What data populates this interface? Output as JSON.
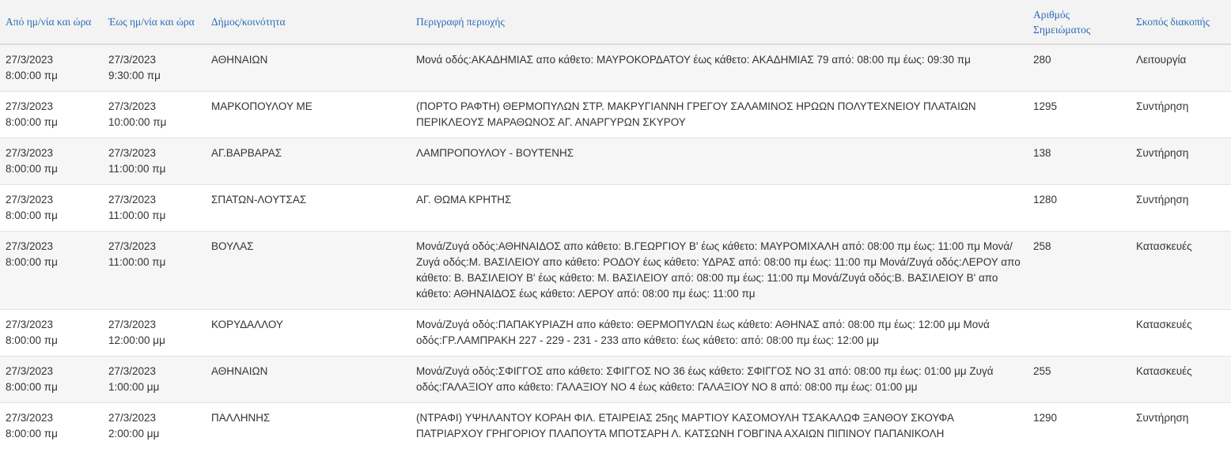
{
  "table": {
    "headers": {
      "from": "Από ημ/νία και ώρα",
      "to": "Έως ημ/νία και ώρα",
      "municipality": "Δήμος/κοινότητα",
      "description": "Περιγραφή περιοχής",
      "ref_line1": "Αριθμός",
      "ref_line2": "Σημειώματος",
      "purpose": "Σκοπός διακοπής"
    },
    "rows": [
      {
        "from_date": "27/3/2023",
        "from_time": "8:00:00 πμ",
        "to_date": "27/3/2023",
        "to_time": "9:30:00 πμ",
        "municipality": "ΑΘΗΝΑΙΩΝ",
        "description": "Μονά οδός:ΑΚΑΔΗΜΙΑΣ απο κάθετο: ΜΑΥΡΟΚΟΡΔΑΤΟΥ έως κάθετο: ΑΚΑΔΗΜΙΑΣ 79 από: 08:00 πμ έως: 09:30 πμ",
        "ref": "280",
        "purpose": "Λειτουργία"
      },
      {
        "from_date": "27/3/2023",
        "from_time": "8:00:00 πμ",
        "to_date": "27/3/2023",
        "to_time": "10:00:00 πμ",
        "municipality": "ΜΑΡΚΟΠΟΥΛΟΥ ΜΕ",
        "description": "(ΠΟΡΤΟ ΡΑΦΤΗ) ΘΕΡΜΟΠΥΛΩΝ ΣΤΡ. ΜΑΚΡΥΓΙΑΝΝΗ ΓΡΕΓΟΥ ΣΑΛΑΜΙΝΟΣ ΗΡΩΩΝ ΠΟΛΥΤΕΧΝΕΙΟΥ ΠΛΑΤΑΙΩΝ ΠΕΡΙΚΛΕΟΥΣ ΜΑΡΑΘΩΝΟΣ ΑΓ. ΑΝΑΡΓΥΡΩΝ ΣΚΥΡΟΥ",
        "ref": "1295",
        "purpose": "Συντήρηση"
      },
      {
        "from_date": "27/3/2023",
        "from_time": "8:00:00 πμ",
        "to_date": "27/3/2023",
        "to_time": "11:00:00 πμ",
        "municipality": "ΑΓ.ΒΑΡΒΑΡΑΣ",
        "description": "ΛΑΜΠΡΟΠΟΥΛΟΥ - ΒΟΥΤΕΝΗΣ",
        "ref": "138",
        "purpose": "Συντήρηση"
      },
      {
        "from_date": "27/3/2023",
        "from_time": "8:00:00 πμ",
        "to_date": "27/3/2023",
        "to_time": "11:00:00 πμ",
        "municipality": "ΣΠΑΤΩΝ-ΛΟΥΤΣΑΣ",
        "description": "ΑΓ. ΘΩΜΑ ΚΡΗΤΗΣ",
        "ref": "1280",
        "purpose": "Συντήρηση"
      },
      {
        "from_date": "27/3/2023",
        "from_time": "8:00:00 πμ",
        "to_date": "27/3/2023",
        "to_time": "11:00:00 πμ",
        "municipality": "ΒΟΥΛΑΣ",
        "description": "Μονά/Ζυγά οδός:ΑΘΗΝΑΙΔΟΣ απο κάθετο: Β.ΓΕΩΡΓΙΟΥ Β' έως κάθετο: ΜΑΥΡΟΜΙΧΑΛΗ από: 08:00 πμ έως: 11:00 πμ Μονά/Ζυγά οδός:Μ. ΒΑΣΙΛΕΙΟΥ απο κάθετο: ΡΟΔΟΥ έως κάθετο: ΥΔΡΑΣ από: 08:00 πμ έως: 11:00 πμ Μονά/Ζυγά οδός:ΛΕΡΟΥ απο κάθετο: Β. ΒΑΣΙΛΕΙΟΥ Β' έως κάθετο: Μ. ΒΑΣΙΛΕΙΟΥ από: 08:00 πμ έως: 11:00 πμ Μονά/Ζυγά οδός:Β. ΒΑΣΙΛΕΙΟΥ Β' απο κάθετο: ΑΘΗΝΑΙΔΟΣ έως κάθετο: ΛΕΡΟΥ από: 08:00 πμ έως: 11:00 πμ",
        "ref": "258",
        "purpose": "Κατασκευές"
      },
      {
        "from_date": "27/3/2023",
        "from_time": "8:00:00 πμ",
        "to_date": "27/3/2023",
        "to_time": "12:00:00 μμ",
        "municipality": "ΚΟΡΥΔΑΛΛΟΥ",
        "description": "Μονά/Ζυγά οδός:ΠΑΠΑΚΥΡΙΑΖΗ απο κάθετο: ΘΕΡΜΟΠΥΛΩΝ έως κάθετο: ΑΘΗΝΑΣ από: 08:00 πμ έως: 12:00 μμ Μονά οδός:ΓΡ.ΛΑΜΠΡΑΚΗ 227 - 229 - 231 - 233 απο κάθετο: έως κάθετο: από: 08:00 πμ έως: 12:00 μμ",
        "ref": "",
        "purpose": "Κατασκευές"
      },
      {
        "from_date": "27/3/2023",
        "from_time": "8:00:00 πμ",
        "to_date": "27/3/2023",
        "to_time": "1:00:00 μμ",
        "municipality": "ΑΘΗΝΑΙΩΝ",
        "description": "Μονά/Ζυγά οδός:ΣΦΙΓΓΟΣ απο κάθετο: ΣΦΙΓΓΟΣ ΝΟ 36 έως κάθετο: ΣΦΙΓΓΟΣ ΝΟ 31 από: 08:00 πμ έως: 01:00 μμ Ζυγά οδός:ΓΑΛΑΞΙΟΥ απο κάθετο: ΓΑΛΑΞΙΟΥ ΝΟ 4 έως κάθετο: ΓΑΛΑΞΙΟΥ ΝΟ 8 από: 08:00 πμ έως: 01:00 μμ",
        "ref": "255",
        "purpose": "Κατασκευές"
      },
      {
        "from_date": "27/3/2023",
        "from_time": "8:00:00 πμ",
        "to_date": "27/3/2023",
        "to_time": "2:00:00 μμ",
        "municipality": "ΠΑΛΛΗΝΗΣ",
        "description": "(ΝΤΡΑΦΙ) ΥΨΗΛΑΝΤΟΥ ΚΟΡΑΗ ΦΙΛ. ΕΤΑΙΡΕΙΑΣ 25ης ΜΑΡΤΙΟΥ ΚΑΣΟΜΟΥΛΗ ΤΣΑΚΑΛΩΦ ΞΑΝΘΟΥ ΣΚΟΥΦΑ ΠΑΤΡΙΑΡΧΟΥ ΓΡΗΓΟΡΙΟΥ ΠΛΑΠΟΥΤΑ ΜΠΟΤΣΑΡΗ Λ. ΚΑΤΣΩΝΗ ΓΟΒΓΙΝΑ ΑΧΑΙΩΝ ΠΙΠΙΝΟΥ ΠΑΠΑΝΙΚΟΛΗ",
        "ref": "1290",
        "purpose": "Συντήρηση"
      }
    ]
  }
}
